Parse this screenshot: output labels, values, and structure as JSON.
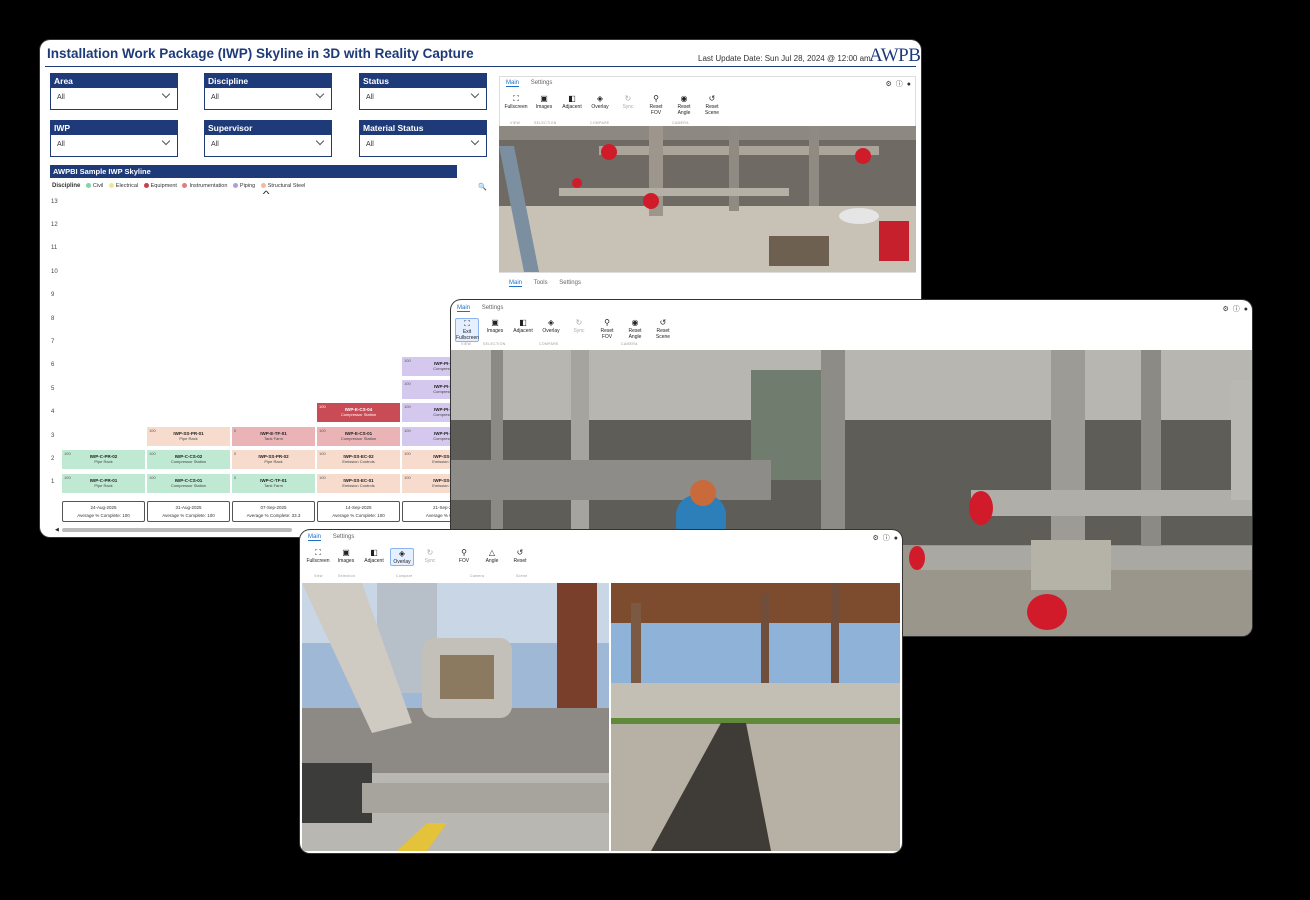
{
  "dashboard": {
    "title": "Installation Work Package (IWP) Skyline in 3D with Reality Capture",
    "last_update": "Last Update Date: Sun Jul 28, 2024 @ 12:00 am",
    "logo": "AWPBI",
    "filters": [
      {
        "label": "Area",
        "value": "All"
      },
      {
        "label": "Discipline",
        "value": "All"
      },
      {
        "label": "Status",
        "value": "All"
      },
      {
        "label": "IWP",
        "value": "All"
      },
      {
        "label": "Supervisor",
        "value": "All"
      },
      {
        "label": "Material Status",
        "value": "All"
      }
    ],
    "chart_title": "AWPBI Sample IWP Skyline",
    "legend_title": "Discipline",
    "legend": [
      {
        "name": "Civil",
        "color": "#7fd6a8"
      },
      {
        "name": "Electrical",
        "color": "#f0e68c"
      },
      {
        "name": "Equipment",
        "color": "#c8404a"
      },
      {
        "name": "Instrumentation",
        "color": "#e27d7d"
      },
      {
        "name": "Piping",
        "color": "#b39ddb"
      },
      {
        "name": "Structural Steel",
        "color": "#f4b89a"
      }
    ],
    "y_ticks": [
      "13",
      "12",
      "11",
      "10",
      "9",
      "8",
      "7",
      "6",
      "5",
      "4",
      "3",
      "2",
      "1"
    ]
  },
  "chart_data": {
    "type": "bar",
    "title": "AWPBI Sample IWP Skyline",
    "categories": [
      "24-Aug-2025",
      "31-Aug-2025",
      "07-Sep-2025",
      "14-Sep-2025",
      "21-Sep-20"
    ],
    "ylim": [
      0,
      13
    ],
    "weeks": [
      {
        "date": "24-Aug-2025",
        "avg": "Average % Complete: 100",
        "blocks": [
          {
            "level": 1,
            "pct": "100",
            "name": "IWP-C-PR-01",
            "loc": "Pipe Rack",
            "discipline": "Civil"
          },
          {
            "level": 2,
            "pct": "100",
            "name": "IWP-C-PR-02",
            "loc": "Pipe Rack",
            "discipline": "Civil"
          }
        ]
      },
      {
        "date": "31-Aug-2025",
        "avg": "Average % Complete: 100",
        "blocks": [
          {
            "level": 1,
            "pct": "100",
            "name": "IWP-C-CS-01",
            "loc": "Compressor Station",
            "discipline": "Civil"
          },
          {
            "level": 2,
            "pct": "100",
            "name": "IWP-C-CS-02",
            "loc": "Compressor Station",
            "discipline": "Civil"
          },
          {
            "level": 3,
            "pct": "100",
            "name": "IWP-SS-PR-01",
            "loc": "Pipe Rack",
            "discipline": "Structural Steel"
          }
        ]
      },
      {
        "date": "07-Sep-2025",
        "avg": "Average % Complete: 33.3",
        "blocks": [
          {
            "level": 1,
            "pct": "0",
            "name": "IWP-C-TF-01",
            "loc": "Tank Farm",
            "discipline": "Civil"
          },
          {
            "level": 2,
            "pct": "0",
            "name": "IWP-SS-PR-02",
            "loc": "Pipe Rack",
            "discipline": "Structural Steel"
          },
          {
            "level": 3,
            "pct": "0",
            "name": "IWP-E-TF-01",
            "loc": "Tank Farm",
            "discipline": "Instrumentation"
          }
        ]
      },
      {
        "date": "14-Sep-2025",
        "avg": "Average % Complete: 100",
        "blocks": [
          {
            "level": 1,
            "pct": "100",
            "name": "IWP-SS-EC-01",
            "loc": "Emission Controls",
            "discipline": "Structural Steel"
          },
          {
            "level": 2,
            "pct": "100",
            "name": "IWP-SS-EC-02",
            "loc": "Emission Controls",
            "discipline": "Structural Steel"
          },
          {
            "level": 3,
            "pct": "100",
            "name": "IWP-E-CS-01",
            "loc": "Compressor Station",
            "discipline": "Instrumentation"
          },
          {
            "level": 4,
            "pct": "100",
            "name": "IWP-E-CS-04",
            "loc": "Compressor Station",
            "discipline": "Equipment"
          }
        ]
      },
      {
        "date": "21-Sep-20",
        "avg": "Average % Comp",
        "blocks": [
          {
            "level": 1,
            "pct": "100",
            "name": "IWP-SS-E",
            "loc": "Emission Co",
            "discipline": "Structural Steel"
          },
          {
            "level": 2,
            "pct": "100",
            "name": "IWP-SS-E",
            "loc": "Emission Co",
            "discipline": "Structural Steel"
          },
          {
            "level": 3,
            "pct": "100",
            "name": "IWP-PI-C",
            "loc": "Compresso",
            "discipline": "Piping"
          },
          {
            "level": 4,
            "pct": "100",
            "name": "IWP-PI-C",
            "loc": "Compresso",
            "discipline": "Piping"
          },
          {
            "level": 5,
            "pct": "100",
            "name": "IWP-PI-C",
            "loc": "Compresso",
            "discipline": "Piping"
          },
          {
            "level": 6,
            "pct": "100",
            "name": "IWP-PI-C",
            "loc": "Compresso",
            "discipline": "Piping"
          }
        ]
      }
    ]
  },
  "viewer1": {
    "tabs": [
      "Main",
      "Settings"
    ],
    "buttons": [
      "Fullscreen",
      "Images",
      "Adjacent",
      "Overlay",
      "Sync",
      "Reset FOV",
      "Reset Angle",
      "Reset Scene"
    ],
    "groups": [
      "VIEW",
      "SELECTION",
      "COMPARE",
      "CAMERA"
    ],
    "bottom_tabs": [
      "Main",
      "Tools",
      "Settings"
    ]
  },
  "viewer2": {
    "tabs": [
      "Main",
      "Settings"
    ],
    "buttons": [
      "Exit Fullscreen",
      "Images",
      "Adjacent",
      "Overlay",
      "Sync",
      "Reset FOV",
      "Reset Angle",
      "Reset Scene"
    ],
    "groups": [
      "VIEW",
      "SELECTION",
      "COMPARE",
      "CAMERA"
    ]
  },
  "viewer3": {
    "tabs": [
      "Main",
      "Settings"
    ],
    "buttons": [
      "Fullscreen",
      "Images",
      "Adjacent",
      "Overlay",
      "Sync",
      "FOV",
      "Angle",
      "Reset"
    ],
    "groups": [
      "View",
      "Selection",
      "Compare",
      "Camera",
      "Scene"
    ]
  }
}
